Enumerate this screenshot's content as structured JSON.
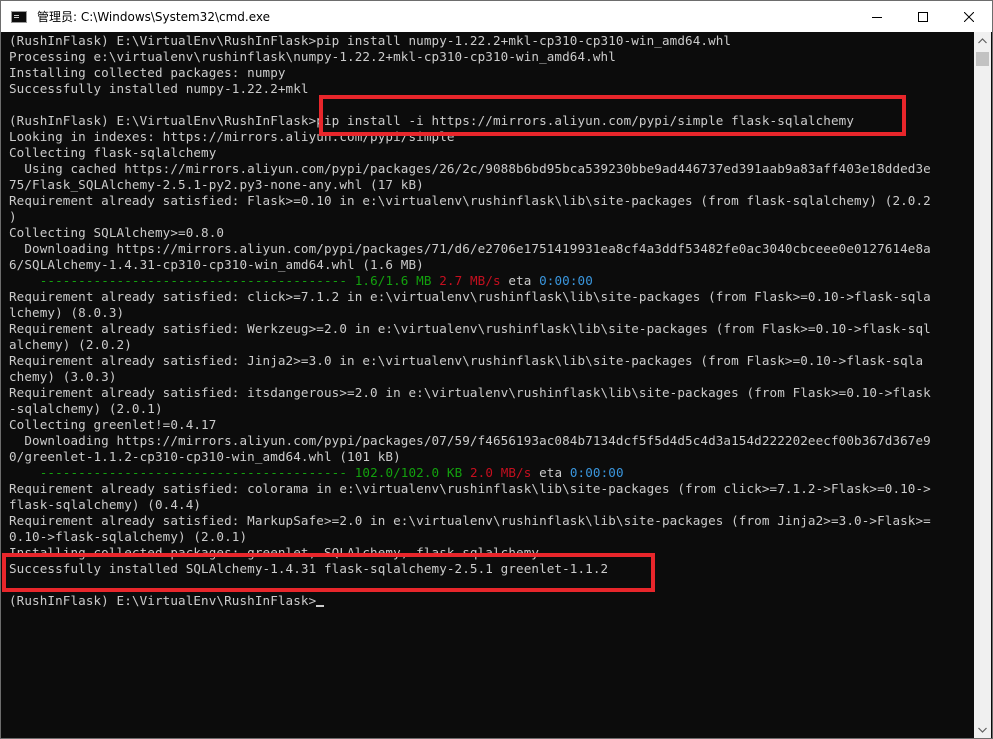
{
  "window": {
    "title": "管理员: C:\\Windows\\System32\\cmd.exe",
    "app_icon": "cmd-icon",
    "controls": {
      "minimize_icon": "minimize-icon",
      "maximize_icon": "maximize-icon",
      "close_icon": "close-icon"
    }
  },
  "console": {
    "lines": [
      "(RushInFlask) E:\\VirtualEnv\\RushInFlask>pip install numpy-1.22.2+mkl-cp310-cp310-win_amd64.whl",
      "Processing e:\\virtualenv\\rushinflask\\numpy-1.22.2+mkl-cp310-cp310-win_amd64.whl",
      "Installing collected packages: numpy",
      "Successfully installed numpy-1.22.2+mkl",
      "",
      "(RushInFlask) E:\\VirtualEnv\\RushInFlask>pip install -i https://mirrors.aliyun.com/pypi/simple flask-sqlalchemy",
      "Looking in indexes: https://mirrors.aliyun.com/pypi/simple",
      "Collecting flask-sqlalchemy",
      "  Using cached https://mirrors.aliyun.com/pypi/packages/26/2c/9088b6bd95bca539230bbe9ad446737ed391aab9a83aff403e18dded3e",
      "75/Flask_SQLAlchemy-2.5.1-py2.py3-none-any.whl (17 kB)",
      "Requirement already satisfied: Flask>=0.10 in e:\\virtualenv\\rushinflask\\lib\\site-packages (from flask-sqlalchemy) (2.0.2",
      ")",
      "Collecting SQLAlchemy>=0.8.0",
      "  Downloading https://mirrors.aliyun.com/pypi/packages/71/d6/e2706e1751419931ea8cf4a3ddf53482fe0ac3040cbceee0e0127614e8a",
      "6/SQLAlchemy-1.4.31-cp310-cp310-win_amd64.whl (1.6 MB)",
      "",
      "Requirement already satisfied: click>=7.1.2 in e:\\virtualenv\\rushinflask\\lib\\site-packages (from Flask>=0.10->flask-sqla",
      "lchemy) (8.0.3)",
      "Requirement already satisfied: Werkzeug>=2.0 in e:\\virtualenv\\rushinflask\\lib\\site-packages (from Flask>=0.10->flask-sql",
      "alchemy) (2.0.2)",
      "Requirement already satisfied: Jinja2>=3.0 in e:\\virtualenv\\rushinflask\\lib\\site-packages (from Flask>=0.10->flask-sqla",
      "chemy) (3.0.3)",
      "Requirement already satisfied: itsdangerous>=2.0 in e:\\virtualenv\\rushinflask\\lib\\site-packages (from Flask>=0.10->flask",
      "-sqlalchemy) (2.0.1)",
      "Collecting greenlet!=0.4.17",
      "  Downloading https://mirrors.aliyun.com/pypi/packages/07/59/f4656193ac084b7134dcf5f5d4d5c4d3a154d222202eecf00b367d367e9",
      "0/greenlet-1.1.2-cp310-cp310-win_amd64.whl (101 kB)",
      "",
      "Requirement already satisfied: colorama in e:\\virtualenv\\rushinflask\\lib\\site-packages (from click>=7.1.2->Flask>=0.10->",
      "flask-sqlalchemy) (0.4.4)",
      "Requirement already satisfied: MarkupSafe>=2.0 in e:\\virtualenv\\rushinflask\\lib\\site-packages (from Jinja2>=3.0->Flask>=",
      "0.10->flask-sqlalchemy) (2.0.1)",
      "Installing collected packages: greenlet, SQLAlchemy, flask-sqlalchemy",
      "Successfully installed SQLAlchemy-1.4.31 flask-sqlalchemy-2.5.1 greenlet-1.1.2",
      "",
      "(RushInFlask) E:\\VirtualEnv\\RushInFlask>"
    ],
    "progress_1": {
      "bar": "----------------------------------------",
      "size": "1.6/1.6 MB",
      "speed": "2.7 MB/s",
      "eta_label": "eta",
      "eta": "0:00:00",
      "fraction": 1.0
    },
    "progress_2": {
      "bar": "----------------------------------------",
      "size": "102.0/102.0 KB",
      "speed": "2.0 MB/s",
      "eta_label": "eta",
      "eta": "0:00:00",
      "fraction": 1.0
    }
  },
  "colors": {
    "console_bg": "#0c0c0c",
    "console_text": "#cccccc",
    "progress_green": "#13a10e",
    "progress_red": "#c50f1f",
    "eta_cyan": "#3a96dd",
    "highlight_red": "#e8262b"
  }
}
